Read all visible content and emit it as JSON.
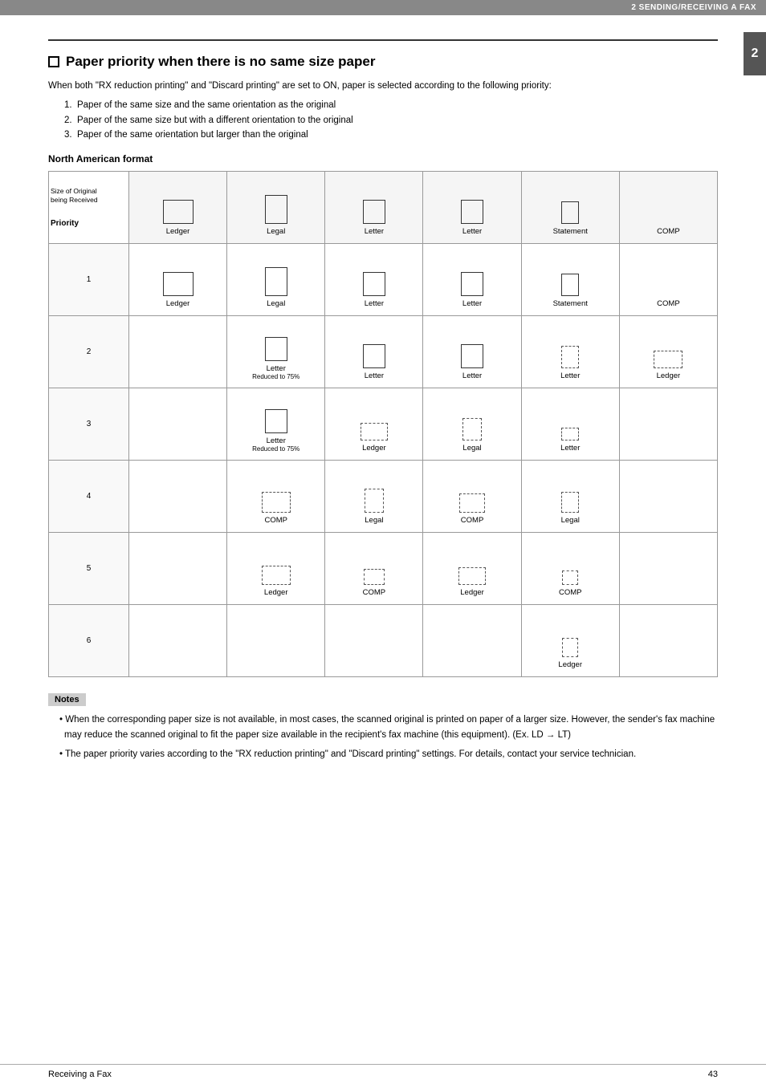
{
  "topbar": {
    "label": "2 SENDING/RECEIVING A FAX"
  },
  "chapter_number": "2",
  "section": {
    "title": "Paper priority when there is no same size paper",
    "intro": "When both \"RX reduction printing\" and \"Discard printing\" are set to ON, paper is selected according to the following priority:",
    "list_items": [
      "Paper of the same size and the same orientation as the original",
      "Paper of the same size but with a different orientation to the original",
      "Paper of the same orientation but larger than the original"
    ]
  },
  "subsection_title": "North American format",
  "table": {
    "header_diagonal": "Size of Original\nbeing Received",
    "header_priority": "Priority",
    "columns": [
      "Ledger",
      "Legal",
      "Letter",
      "Letter",
      "Statement",
      "COMP"
    ],
    "rows": [
      {
        "priority": "1",
        "cells": [
          {
            "type": "solid",
            "shape": "ledger",
            "label": "Ledger"
          },
          {
            "type": "solid",
            "shape": "legal",
            "label": "Legal"
          },
          {
            "type": "solid",
            "shape": "letter",
            "label": "Letter"
          },
          {
            "type": "solid",
            "shape": "letter",
            "label": "Letter"
          },
          {
            "type": "solid",
            "shape": "statement",
            "label": "Statement"
          },
          {
            "type": "text",
            "label": "COMP"
          }
        ]
      },
      {
        "priority": "2",
        "cells": [
          {
            "type": "empty"
          },
          {
            "type": "solid",
            "shape": "letter",
            "label": "Letter",
            "sublabel": "Reduced to 75%"
          },
          {
            "type": "solid",
            "shape": "letter",
            "label": "Letter"
          },
          {
            "type": "solid",
            "shape": "letter",
            "label": "Letter"
          },
          {
            "type": "dashed",
            "shape": "letter-dashed",
            "label": "Letter"
          },
          {
            "type": "dashed",
            "shape": "ledger-dashed",
            "label": "Ledger"
          }
        ]
      },
      {
        "priority": "3",
        "cells": [
          {
            "type": "empty"
          },
          {
            "type": "solid",
            "shape": "letter",
            "label": "Letter",
            "sublabel": "Reduced to 75%"
          },
          {
            "type": "dashed",
            "shape": "ledger-dashed",
            "label": "Ledger"
          },
          {
            "type": "dashed",
            "shape": "legal-dashed",
            "label": "Legal"
          },
          {
            "type": "dashed",
            "shape": "letter-dashed",
            "label": "Letter"
          },
          {
            "type": "empty"
          }
        ]
      },
      {
        "priority": "4",
        "cells": [
          {
            "type": "empty"
          },
          {
            "type": "dashed",
            "shape": "comp-dashed",
            "label": "COMP"
          },
          {
            "type": "dashed",
            "shape": "legal-dashed",
            "label": "Legal"
          },
          {
            "type": "dashed",
            "shape": "comp-dashed",
            "label": "COMP"
          },
          {
            "type": "dashed",
            "shape": "legal-dashed",
            "label": "Legal"
          },
          {
            "type": "empty"
          }
        ]
      },
      {
        "priority": "5",
        "cells": [
          {
            "type": "empty"
          },
          {
            "type": "dashed",
            "shape": "ledger-dashed",
            "label": "Ledger"
          },
          {
            "type": "dashed",
            "shape": "comp-dashed",
            "label": "COMP"
          },
          {
            "type": "dashed",
            "shape": "ledger-dashed",
            "label": "Ledger"
          },
          {
            "type": "dashed",
            "shape": "comp-dashed",
            "label": "COMP"
          },
          {
            "type": "empty"
          }
        ]
      },
      {
        "priority": "6",
        "cells": [
          {
            "type": "empty"
          },
          {
            "type": "empty"
          },
          {
            "type": "empty"
          },
          {
            "type": "empty"
          },
          {
            "type": "dashed",
            "shape": "ledger-dashed",
            "label": "Ledger"
          },
          {
            "type": "empty"
          }
        ]
      }
    ]
  },
  "notes": {
    "label": "Notes",
    "items": [
      "When the corresponding paper size is not available, in most cases, the scanned original is printed on paper of a larger size. However, the sender's fax machine may reduce the scanned original to fit the paper size available in the recipient's fax machine (this equipment). (Ex. LD → LT)",
      "The paper priority varies according to the \"RX reduction printing\" and \"Discard printing\" settings. For details, contact your service technician."
    ]
  },
  "footer": {
    "left": "Receiving a Fax",
    "right": "43"
  }
}
